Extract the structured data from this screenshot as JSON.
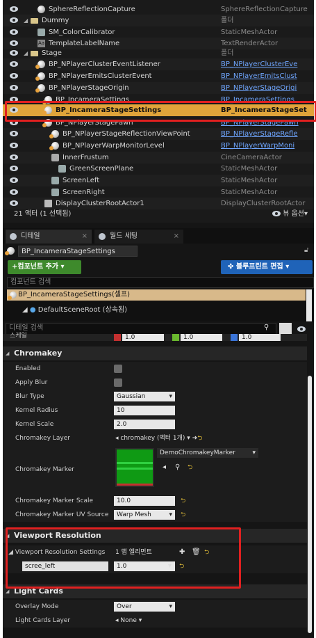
{
  "outliner": {
    "rows": [
      {
        "name": "SphereReflectionCapture",
        "type": "SphereReflectionCapture",
        "indent": 2,
        "icon": "sphere-icon",
        "link": false
      },
      {
        "name": "Dummy",
        "type": "폴더",
        "indent": 1,
        "icon": "folder-icon",
        "link": false
      },
      {
        "name": "SM_ColorCalibrator",
        "type": "StaticMeshActor",
        "indent": 2,
        "icon": "mesh-icon",
        "link": false
      },
      {
        "name": "TemplateLabelName",
        "type": "TextRenderActor",
        "indent": 2,
        "icon": "text-icon",
        "link": false
      },
      {
        "name": "Stage",
        "type": "폴더",
        "indent": 1,
        "icon": "folder-icon",
        "link": false
      },
      {
        "name": "BP_NPlayerClusterEventListener",
        "type": "BP_NPlayerClusterEve",
        "indent": 2,
        "icon": "blueprint-icon",
        "link": true
      },
      {
        "name": "BP_NPlayerEmitsClusterEvent",
        "type": "BP_NPlayerEmitsClust",
        "indent": 2,
        "icon": "blueprint-icon",
        "link": true
      },
      {
        "name": "BP_NPlayerStageOrigin",
        "type": "BP_NPlayerStageOrigi",
        "indent": 2,
        "icon": "blueprint-icon",
        "link": true
      },
      {
        "name": "BP_IncameraSettings",
        "type": "BP_IncameraSettings",
        "indent": 3,
        "icon": "blueprint-icon",
        "link": true
      },
      {
        "name": "BP_IncameraStageSettings",
        "type": "BP_IncameraStageSet",
        "indent": 3,
        "icon": "blueprint-icon",
        "link": true,
        "selected": true
      },
      {
        "name": "BP_NPlayerStagePawn",
        "type": "BP_NPlayerStagePawn",
        "indent": 3,
        "icon": "blueprint-icon",
        "link": true
      },
      {
        "name": "BP_NPlayerStageReflectionViewPoint",
        "type": "BP_NPlayerStageRefle",
        "indent": 4,
        "icon": "blueprint-icon",
        "link": true
      },
      {
        "name": "BP_NPlayerWarpMonitorLevel",
        "type": "BP_NPlayerWarpMoni",
        "indent": 4,
        "icon": "blueprint-icon",
        "link": true
      },
      {
        "name": "InnerFrustum",
        "type": "CineCameraActor",
        "indent": 4,
        "icon": "camera-icon",
        "link": false
      },
      {
        "name": "GreenScreenPlane",
        "type": "StaticMeshActor",
        "indent": 5,
        "icon": "mesh-icon",
        "link": false
      },
      {
        "name": "ScreenLeft",
        "type": "StaticMeshActor",
        "indent": 4,
        "icon": "mesh-icon",
        "link": false
      },
      {
        "name": "ScreenRight",
        "type": "StaticMeshActor",
        "indent": 4,
        "icon": "mesh-icon",
        "link": false
      },
      {
        "name": "DisplayClusterRootActor1",
        "type": "DisplayClusterRootActor",
        "indent": 3,
        "icon": "root-icon",
        "link": false
      }
    ],
    "footer_count": "21 액터 (1 선택됨)",
    "view_options": "뷰 옵션"
  },
  "tabs": [
    {
      "label": "디테일"
    },
    {
      "label": "월드 세팅"
    }
  ],
  "actor_name": "BP_IncameraStageSettings",
  "buttons": {
    "add_component": "+컴포넌트 추가",
    "blueprint_edit": "블루프린트 편집"
  },
  "component_search": {
    "placeholder": "컴포넌트 검색"
  },
  "components": {
    "self": "BP_IncameraStageSettings(셀프)",
    "root": "DefaultSceneRoot (상속됨)"
  },
  "details_search": {
    "placeholder": "디테일 검색"
  },
  "scale_row": {
    "x": "1.0",
    "y": "1.0",
    "z": "1.0"
  },
  "chromakey": {
    "title": "Chromakey",
    "enabled_label": "Enabled",
    "apply_blur_label": "Apply Blur",
    "blur_type_label": "Blur Type",
    "blur_type_value": "Gaussian",
    "kernel_radius_label": "Kernel Radius",
    "kernel_radius_value": "10",
    "kernel_scale_label": "Kernel Scale",
    "kernel_scale_value": "2.0",
    "layer_label": "Chromakey Layer",
    "layer_value": "chromakey (액터 1개)",
    "marker_label": "Chromakey Marker",
    "marker_asset": "DemoChromakeyMarker",
    "marker_scale_label": "Chromakey Marker Scale",
    "marker_scale_value": "10.0",
    "marker_uv_label": "Chromakey Marker UV Source",
    "marker_uv_value": "Warp Mesh"
  },
  "viewport": {
    "title": "Viewport Resolution",
    "settings_label": "Viewport Resolution Settings",
    "settings_value": "1 맵 엘리먼트",
    "entry_key": "scree_left",
    "entry_value": "1.0"
  },
  "light_cards": {
    "title": "Light Cards",
    "overlay_label": "Overlay Mode",
    "overlay_value": "Over",
    "layer_label": "Light Cards Layer",
    "layer_value": "None"
  },
  "colors": {
    "selection": "#e0a43a",
    "highlight_box": "#e02020",
    "add_button": "#3e8a2c",
    "blueprint_button": "#1f63b8"
  }
}
